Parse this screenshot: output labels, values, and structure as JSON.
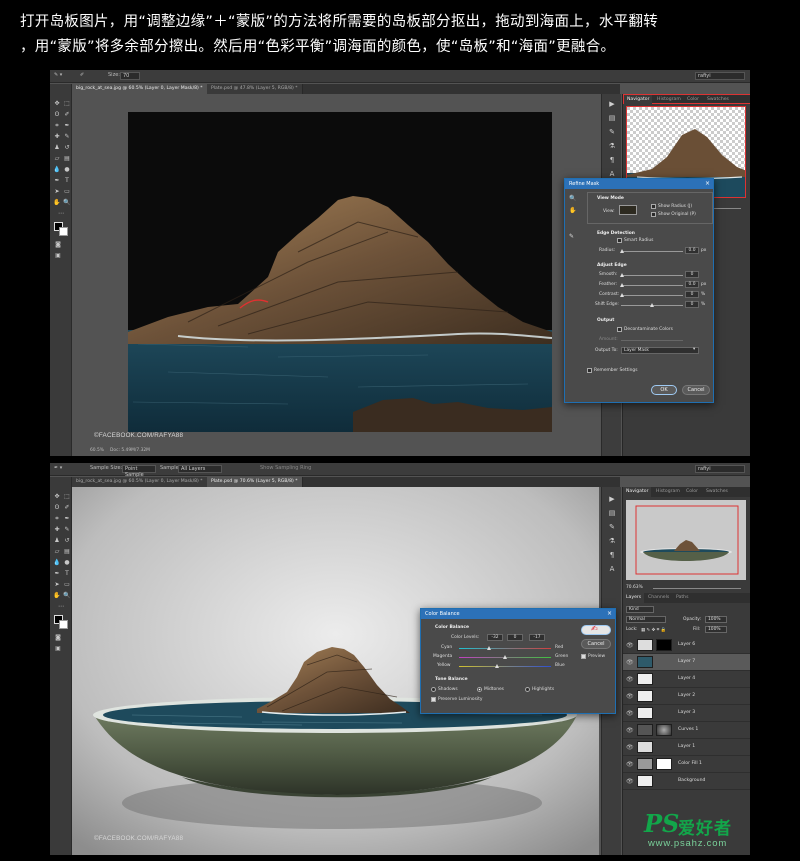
{
  "caption": {
    "line1": "打开岛板图片，用“调整边缘”＋“蒙版”的方法将所需要的岛板部分抠出，拖动到海面上，水平翻转",
    "line2": "，用“蒙版”将多余部分擦出。然后用“色彩平衡”调海面的颜色，使“岛板”和“海面”更融合。"
  },
  "shot1": {
    "options": {
      "size_label": "Size:",
      "size_value": "70",
      "workspace": "rafiyi"
    },
    "tabs": [
      "big_rock_at_sea.jpg @ 60.5% (Layer 0, Layer Mask/8) *",
      "Plate.psd @ 47.8% (Layer 5, RGB/8) *"
    ],
    "panel_tabs": [
      "Navigator",
      "Histogram",
      "Color",
      "Swatches"
    ],
    "watermark": "©FACEBOOK.COM/RAFYA88",
    "status": {
      "zoom": "60.5%",
      "doc": "Doc: 5.49M/7.32M"
    },
    "refine_mask": {
      "title": "Refine Mask",
      "view_mode": "View Mode",
      "view_label": "View:",
      "show_radius": "Show Radius (J)",
      "show_original": "Show Original (P)",
      "edge_detection": "Edge Detection",
      "smart_radius": "Smart Radius",
      "radius_label": "Radius:",
      "radius_value": "0.0",
      "radius_unit": "px",
      "adjust_edge": "Adjust Edge",
      "smooth_label": "Smooth:",
      "smooth_value": "0",
      "feather_label": "Feather:",
      "feather_value": "0.0",
      "feather_unit": "px",
      "contrast_label": "Contrast:",
      "contrast_value": "0",
      "contrast_unit": "%",
      "shift_label": "Shift Edge:",
      "shift_value": "0",
      "shift_unit": "%",
      "output": "Output",
      "decontaminate": "Decontaminate Colors",
      "amount_label": "Amount:",
      "output_to_label": "Output To:",
      "output_to_value": "Layer Mask",
      "remember": "Remember Settings",
      "ok": "OK",
      "cancel": "Cancel"
    }
  },
  "shot2": {
    "options": {
      "sample_size_label": "Sample Size:",
      "sample_size_value": "Point Sample",
      "sample_label": "Sample:",
      "sample_value": "All Layers",
      "show_ring": "Show Sampling Ring",
      "workspace": "rafiyi"
    },
    "tabs": [
      "big_rock_at_sea.jpg @ 60.5% (Layer 0, Layer Mask/8) *",
      "Plate.psd @ 70.6% (Layer 5, RGB/8) *"
    ],
    "panel_tabs": [
      "Navigator",
      "Histogram",
      "Color",
      "Swatches"
    ],
    "nav_zoom": "70.63%",
    "layer_tabs": [
      "Layers",
      "Channels",
      "Paths"
    ],
    "layer_kind": "Kind",
    "blend_mode": "Normal",
    "opacity_label": "Opacity:",
    "opacity_value": "100%",
    "lock_label": "Lock:",
    "fill_label": "Fill:",
    "fill_value": "100%",
    "layers": [
      "Layer 6",
      "Layer 7",
      "Layer 4",
      "Layer 2",
      "Layer 3",
      "Curves 1",
      "Layer 1",
      "Color Fill 1",
      "Background"
    ],
    "watermark": "©FACEBOOK.COM/RAFYA88",
    "color_balance": {
      "title": "Color Balance",
      "section": "Color Balance",
      "levels_label": "Color Levels:",
      "levels": [
        "-32",
        "0",
        "-17"
      ],
      "cyan": "Cyan",
      "red": "Red",
      "magenta": "Magenta",
      "green": "Green",
      "yellow": "Yellow",
      "blue": "Blue",
      "tone_balance": "Tone Balance",
      "shadows": "Shadows",
      "midtones": "Midtones",
      "highlights": "Highlights",
      "preserve": "Preserve Luminosity",
      "ok": "OK",
      "cancel": "Cancel",
      "preview": "Preview"
    }
  },
  "logo": {
    "ps": "PS",
    "cn": "爱好者",
    "url": "www.psahz.com"
  },
  "colors": {
    "dialog_title": "#2c71b8",
    "logo_green": "#12a64a"
  }
}
